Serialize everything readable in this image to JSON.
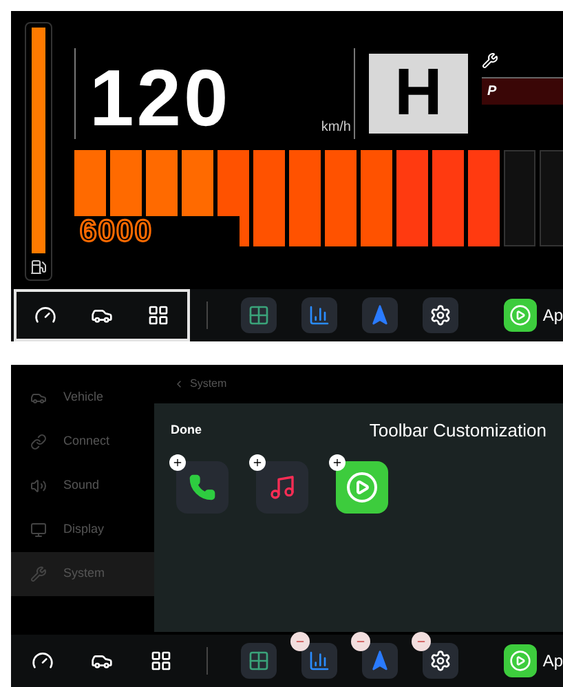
{
  "cluster": {
    "fuel_gauge": {
      "level": 1
    },
    "speed": "120",
    "speed_unit": "km/h",
    "gear": "H",
    "indicator": "P",
    "rpm": "6000",
    "rev_bar": {
      "level": 0.86
    }
  },
  "toolbar_top": {
    "apps": [
      {
        "kind": "grid",
        "removable": false
      },
      {
        "kind": "signal",
        "removable": false
      },
      {
        "kind": "navigation",
        "removable": false
      },
      {
        "kind": "settings",
        "removable": false
      }
    ],
    "carplay_label": "Ap"
  },
  "settings": {
    "sidebar": [
      {
        "label": "Vehicle",
        "selected": false
      },
      {
        "label": "Connect",
        "selected": false
      },
      {
        "label": "Sound",
        "selected": false
      },
      {
        "label": "Display",
        "selected": false
      },
      {
        "label": "System",
        "selected": true
      }
    ],
    "breadcrumb": "System",
    "panel": {
      "done": "Done",
      "title": "Toolbar Customization",
      "apps": [
        {
          "kind": "phone"
        },
        {
          "kind": "music"
        },
        {
          "kind": "carplay"
        }
      ]
    }
  },
  "toolbar_bottom": {
    "apps": [
      {
        "kind": "grid",
        "removable": false
      },
      {
        "kind": "signal",
        "removable": true
      },
      {
        "kind": "navigation",
        "removable": true
      },
      {
        "kind": "settings",
        "removable": true
      }
    ],
    "carplay_label": "Ap"
  }
}
